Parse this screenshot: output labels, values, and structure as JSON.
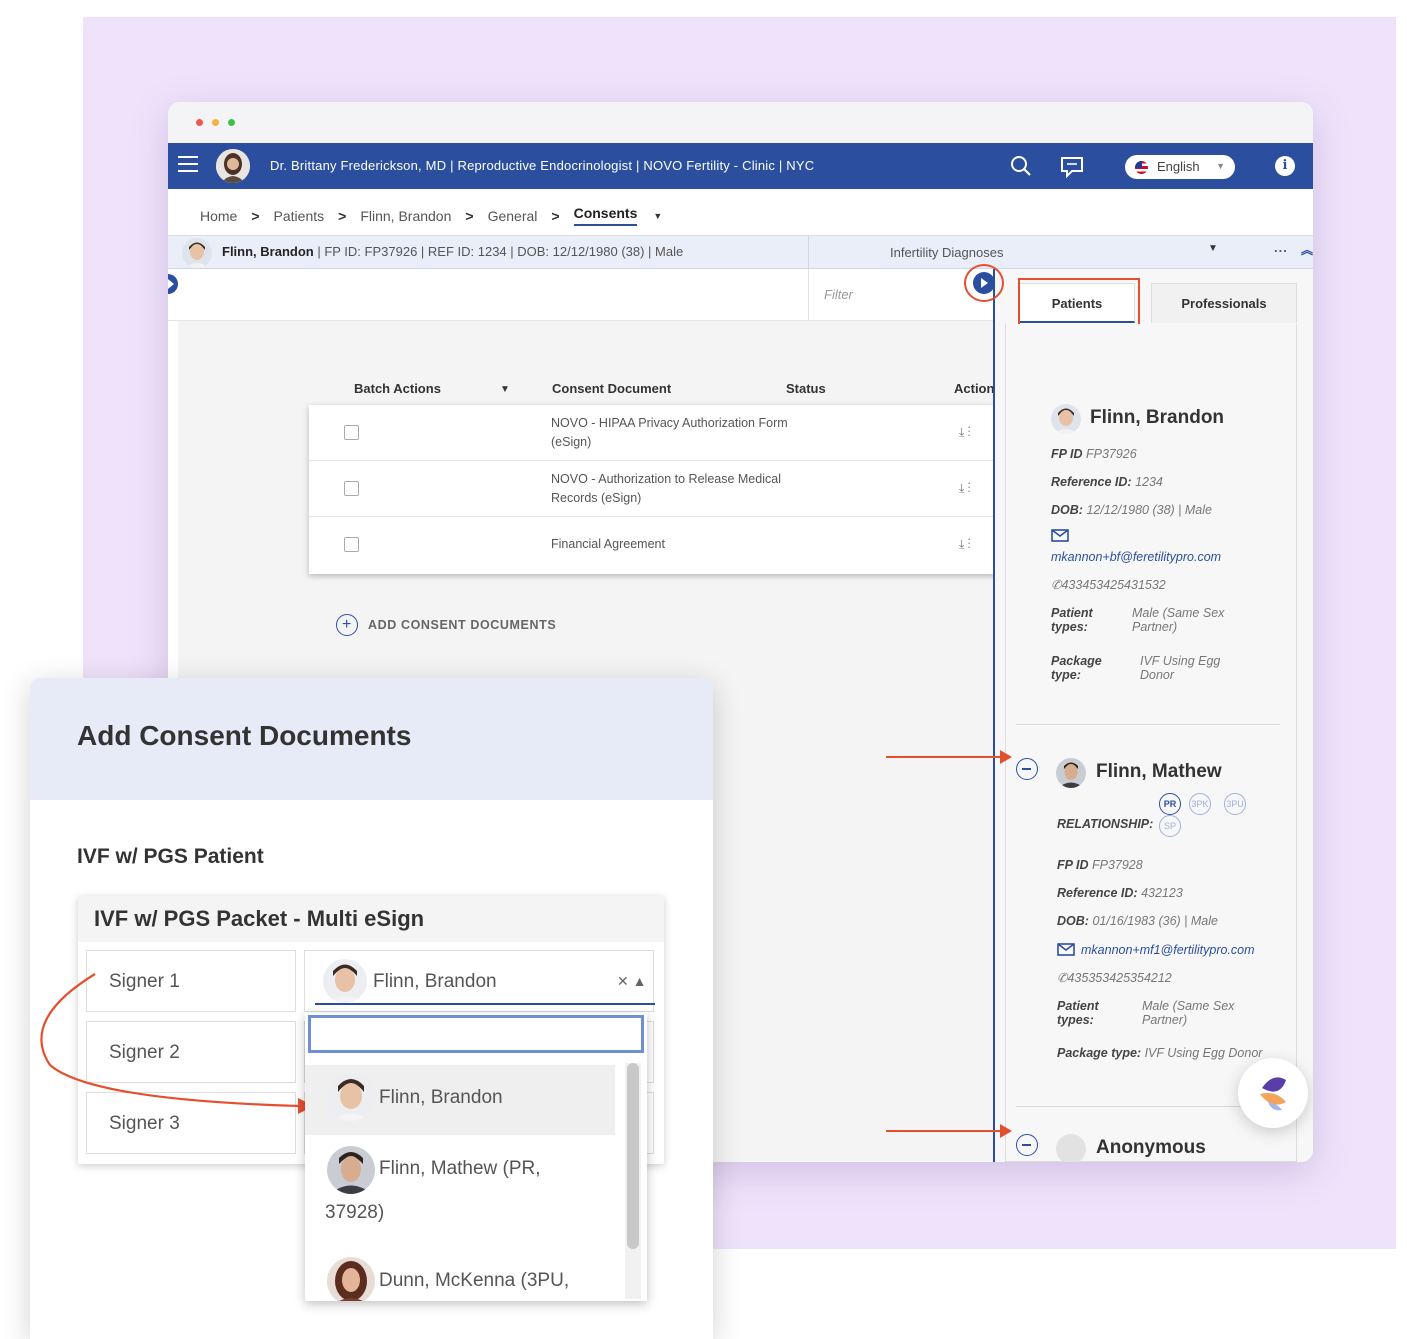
{
  "window": {
    "doctor_title": "Dr. Brittany Frederickson, MD | Reproductive Endocrinologist | NOVO Fertility - Clinic | NYC",
    "language": "English"
  },
  "breadcrumb": [
    "Home",
    "Patients",
    "Flinn, Brandon",
    "General",
    "Consents"
  ],
  "patient_bar": {
    "name": "Flinn, Brandon",
    "details": " | FP ID: FP37926 | REF ID: 1234 | DOB: 12/12/1980 (38) | Male",
    "diagnoses": "Infertility Diagnoses",
    "more": "...",
    "filter_placeholder": "Filter"
  },
  "consents_table": {
    "columns": [
      "Batch Actions",
      "Consent Document",
      "Status",
      "Action"
    ],
    "rows": [
      {
        "document": "NOVO - HIPAA Privacy Authorization Form (eSign)",
        "status": ""
      },
      {
        "document": "NOVO - Authorization to Release Medical Records (eSign)",
        "status": ""
      },
      {
        "document": "Financial Agreement",
        "status": ""
      }
    ],
    "add_label": "ADD CONSENT DOCUMENTS"
  },
  "drawer": {
    "tabs": [
      "Patients",
      "Professionals"
    ],
    "patients": [
      {
        "name": "Flinn, Brandon",
        "fp_id_label": "FP ID",
        "fp_id": "FP37926",
        "ref_label": "Reference ID:",
        "ref_id": "1234",
        "dob_label": "DOB:",
        "dob": "12/12/1980 (38) | Male",
        "email": "mkannon+bf@feretilitypro.com",
        "phone": "433453425431532",
        "ptype_label": "Patient types:",
        "ptype": "Male (Same Sex Partner)",
        "pkg_label": "Package type:",
        "pkg": "IVF Using Egg Donor"
      },
      {
        "name": "Flinn, Mathew",
        "relationship_label": "RELATIONSHIP:",
        "relationships": [
          "PR",
          "3PK",
          "3PU",
          "SP"
        ],
        "fp_id_label": "FP ID",
        "fp_id": "FP37928",
        "ref_label": "Reference ID:",
        "ref_id": "432123",
        "dob_label": "DOB:",
        "dob": "01/16/1983 (36) | Male",
        "email": "mkannon+mf1@fertilitypro.com",
        "phone": "435353425354212",
        "ptype_label": "Patient types:",
        "ptype": "Male (Same Sex Partner)",
        "pkg_label": "Package type:",
        "pkg": "IVF Using Egg Donor"
      },
      {
        "name": "Anonymous"
      }
    ]
  },
  "modal": {
    "title": "Add Consent Documents",
    "section": "IVF w/ PGS Patient",
    "packet_title": "IVF w/ PGS Packet - Multi eSign",
    "signers": [
      "Signer 1",
      "Signer 2",
      "Signer 3"
    ],
    "signer1_value": "Flinn, Brandon",
    "dropdown_options": [
      "Flinn, Brandon",
      "Flinn, Mathew (PR,",
      "37928)",
      "Dunn, McKenna (3PU,"
    ]
  },
  "colors": {
    "brand": "#2b4f9e",
    "highlight": "#e4502f",
    "background": "#efe3fb"
  }
}
